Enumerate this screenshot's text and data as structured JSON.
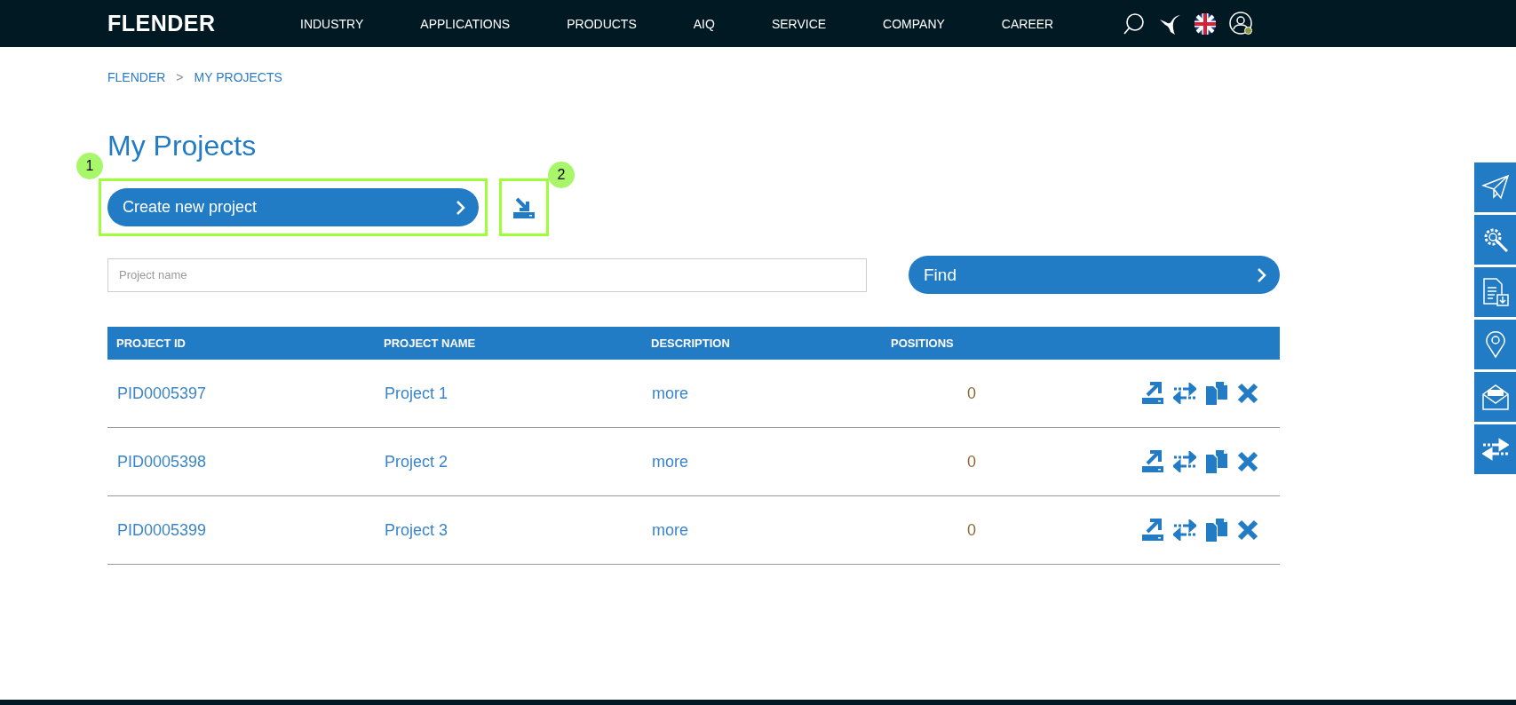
{
  "header": {
    "logo": "FLENDER",
    "nav": [
      "INDUSTRY",
      "APPLICATIONS",
      "PRODUCTS",
      "AIQ",
      "SERVICE",
      "COMPANY",
      "CAREER"
    ]
  },
  "breadcrumb": [
    {
      "label": "FLENDER"
    },
    {
      "label": ">",
      "kind": "separator"
    },
    {
      "label": "MY PROJECTS"
    }
  ],
  "title": "My Projects",
  "create_button": "Create new project",
  "annotations": [
    "1",
    "2"
  ],
  "search": {
    "placeholder": "Project name"
  },
  "find_button": "Find",
  "table": {
    "columns": [
      "PROJECT ID",
      "PROJECT NAME",
      "DESCRIPTION",
      "POSITIONS"
    ],
    "rows": [
      {
        "id": "PID0005397",
        "name": "Project 1",
        "description": "more",
        "positions": "0"
      },
      {
        "id": "PID0005398",
        "name": "Project 2",
        "description": "more",
        "positions": "0"
      },
      {
        "id": "PID0005399",
        "name": "Project 3",
        "description": "more",
        "positions": "0"
      }
    ]
  },
  "side_tabs": [
    {
      "kind": "send"
    },
    {
      "kind": "service"
    },
    {
      "kind": "documents"
    },
    {
      "kind": "location"
    },
    {
      "kind": "quote"
    },
    {
      "kind": "compare"
    }
  ]
}
